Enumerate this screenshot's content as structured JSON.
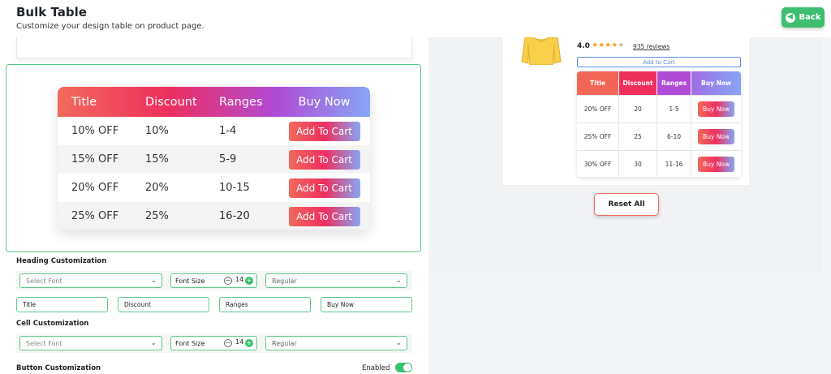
{
  "header": {
    "title": "Bulk Table",
    "subtitle": "Customize your design table on product page.",
    "back_label": "Back"
  },
  "preview_table": {
    "columns": [
      "Title",
      "Discount",
      "Ranges",
      "Buy Now"
    ],
    "rows": [
      {
        "title": "10% OFF",
        "discount": "10%",
        "range": "1-4",
        "button": "Add To Cart"
      },
      {
        "title": "15% OFF",
        "discount": "15%",
        "range": "5-9",
        "button": "Add To Cart"
      },
      {
        "title": "20% OFF",
        "discount": "20%",
        "range": "10-15",
        "button": "Add To Cart"
      },
      {
        "title": "25% OFF",
        "discount": "25%",
        "range": "16-20",
        "button": "Add To Cart"
      }
    ]
  },
  "heading_customization": {
    "label": "Heading Customization",
    "font_placeholder": "Select Font",
    "font_size_label": "Font Size",
    "font_size_value": "14",
    "weight_value": "Regular",
    "inputs": [
      "Title",
      "Discount",
      "Ranges",
      "Buy Now"
    ]
  },
  "cell_customization": {
    "label": "Cell Customization",
    "font_placeholder": "Select Font",
    "font_size_label": "Font Size",
    "font_size_value": "14",
    "weight_value": "Regular"
  },
  "button_customization": {
    "label": "Button Customization",
    "enabled_label": "Enabled",
    "enabled": true
  },
  "product_preview": {
    "rating_value": "4.0",
    "stars_filled": 4,
    "stars_total": 5,
    "reviews_label": "935 reviews",
    "add_to_cart_label": "Add to Cart",
    "columns": [
      "Title",
      "Discount",
      "Ranges",
      "Buy Now"
    ],
    "rows": [
      {
        "title": "20% OFF",
        "discount": "20",
        "range": "1-5",
        "button": "Buy Now"
      },
      {
        "title": "25% OFF",
        "discount": "25",
        "range": "6-10",
        "button": "Buy Now"
      },
      {
        "title": "30% OFF",
        "discount": "30",
        "range": "11-16",
        "button": "Buy Now"
      }
    ],
    "reset_label": "Reset All"
  },
  "colors": {
    "accent_green": "#3cbf6e",
    "gradient_start": "#f06a5b",
    "gradient_mid": "#ef2f5e",
    "gradient_purple": "#b04bd6",
    "gradient_end": "#86a6f5"
  },
  "icons": {
    "back": "arrow-left-circle-icon",
    "dropdown": "chevron-down-icon",
    "product": "sweater-icon",
    "star": "star-icon"
  }
}
